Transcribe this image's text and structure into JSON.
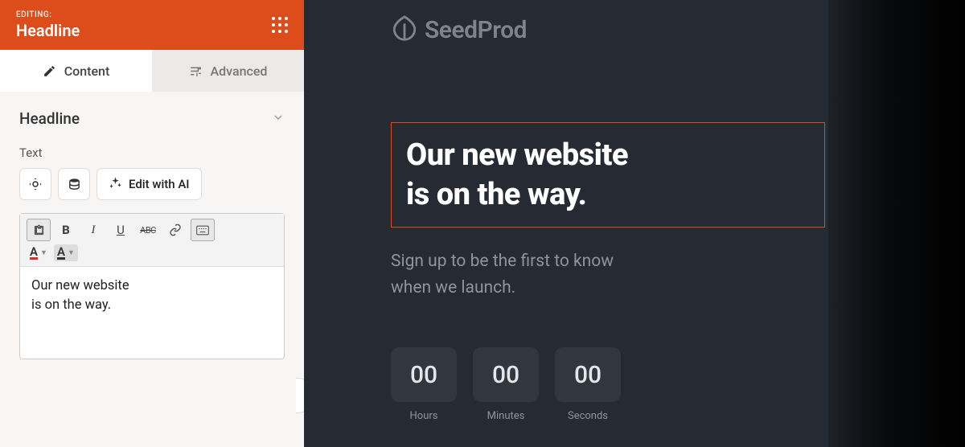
{
  "header": {
    "editing_label": "EDITING:",
    "title": "Headline"
  },
  "tabs": {
    "content": "Content",
    "advanced": "Advanced"
  },
  "accordion": {
    "title": "Headline"
  },
  "field": {
    "label": "Text",
    "ai_button": "Edit with AI"
  },
  "editor": {
    "content": "Our new website\nis on the way."
  },
  "preview": {
    "brand": "SeedProd",
    "headline": "Our new website\nis on the way.",
    "subtext": "Sign up to be the first to know\nwhen we launch.",
    "countdown": [
      {
        "value": "00",
        "label": "Hours"
      },
      {
        "value": "00",
        "label": "Minutes"
      },
      {
        "value": "00",
        "label": "Seconds"
      }
    ]
  }
}
